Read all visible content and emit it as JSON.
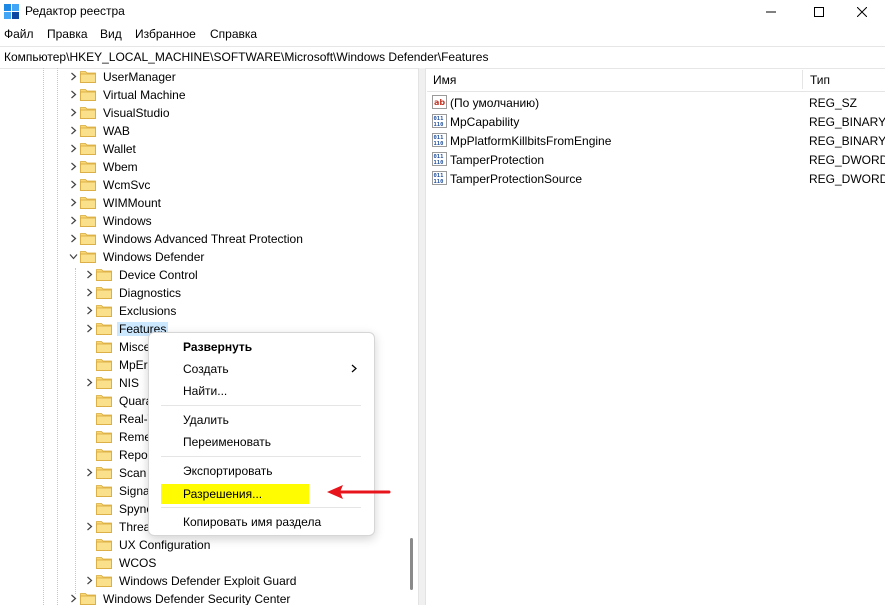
{
  "window": {
    "title": "Редактор реестра",
    "controls": {
      "minimize": "minimize-icon",
      "maximize": "maximize-icon",
      "close": "close-icon"
    }
  },
  "menu": [
    "Файл",
    "Правка",
    "Вид",
    "Избранное",
    "Справка"
  ],
  "address": "Компьютер\\HKEY_LOCAL_MACHINE\\SOFTWARE\\Microsoft\\Windows Defender\\Features",
  "tree": {
    "items": [
      {
        "label": "UserManager",
        "level": 1,
        "expand": "collapsed"
      },
      {
        "label": "Virtual Machine",
        "level": 1,
        "expand": "collapsed"
      },
      {
        "label": "VisualStudio",
        "level": 1,
        "expand": "collapsed"
      },
      {
        "label": "WAB",
        "level": 1,
        "expand": "collapsed"
      },
      {
        "label": "Wallet",
        "level": 1,
        "expand": "collapsed"
      },
      {
        "label": "Wbem",
        "level": 1,
        "expand": "collapsed"
      },
      {
        "label": "WcmSvc",
        "level": 1,
        "expand": "collapsed"
      },
      {
        "label": "WIMMount",
        "level": 1,
        "expand": "collapsed"
      },
      {
        "label": "Windows",
        "level": 1,
        "expand": "collapsed"
      },
      {
        "label": "Windows Advanced Threat Protection",
        "level": 1,
        "expand": "collapsed"
      },
      {
        "label": "Windows Defender",
        "level": 1,
        "expand": "expanded"
      },
      {
        "label": "Device Control",
        "level": 2,
        "expand": "collapsed"
      },
      {
        "label": "Diagnostics",
        "level": 2,
        "expand": "collapsed"
      },
      {
        "label": "Exclusions",
        "level": 2,
        "expand": "collapsed"
      },
      {
        "label": "Features",
        "level": 2,
        "expand": "collapsed",
        "selected": true
      },
      {
        "label": "Misce",
        "level": 2,
        "expand": "none"
      },
      {
        "label": "MpEr",
        "level": 2,
        "expand": "none"
      },
      {
        "label": "NIS",
        "level": 2,
        "expand": "collapsed"
      },
      {
        "label": "Quara",
        "level": 2,
        "expand": "none"
      },
      {
        "label": "Real-T",
        "level": 2,
        "expand": "none"
      },
      {
        "label": "Reme",
        "level": 2,
        "expand": "none"
      },
      {
        "label": "Repo",
        "level": 2,
        "expand": "none"
      },
      {
        "label": "Scan",
        "level": 2,
        "expand": "collapsed"
      },
      {
        "label": "Signa",
        "level": 2,
        "expand": "none"
      },
      {
        "label": "Spyne",
        "level": 2,
        "expand": "none"
      },
      {
        "label": "Threa",
        "level": 2,
        "expand": "collapsed"
      },
      {
        "label": "UX Configuration",
        "level": 2,
        "expand": "none"
      },
      {
        "label": "WCOS",
        "level": 2,
        "expand": "none"
      },
      {
        "label": "Windows Defender Exploit Guard",
        "level": 2,
        "expand": "collapsed"
      },
      {
        "label": "Windows Defender Security Center",
        "level": 1,
        "expand": "collapsed"
      }
    ]
  },
  "list": {
    "columns": {
      "name": "Имя",
      "type": "Тип"
    },
    "rows": [
      {
        "name": "(По умолчанию)",
        "type": "REG_SZ",
        "icon": "string-value-icon"
      },
      {
        "name": "MpCapability",
        "type": "REG_BINARY",
        "icon": "binary-value-icon"
      },
      {
        "name": "MpPlatformKillbitsFromEngine",
        "type": "REG_BINARY",
        "icon": "binary-value-icon"
      },
      {
        "name": "TamperProtection",
        "type": "REG_DWORD",
        "icon": "binary-value-icon"
      },
      {
        "name": "TamperProtectionSource",
        "type": "REG_DWORD",
        "icon": "binary-value-icon"
      }
    ]
  },
  "context_menu": {
    "expand": "Развернуть",
    "create": "Создать",
    "find": "Найти...",
    "delete": "Удалить",
    "rename": "Переименовать",
    "export": "Экспортировать",
    "permissions": "Разрешения...",
    "copy_key_name": "Копировать имя раздела"
  },
  "colors": {
    "selection": "#cce8ff",
    "highlight": "#fffb00",
    "arrow": "#e8141b",
    "folder": "#f8d775"
  }
}
